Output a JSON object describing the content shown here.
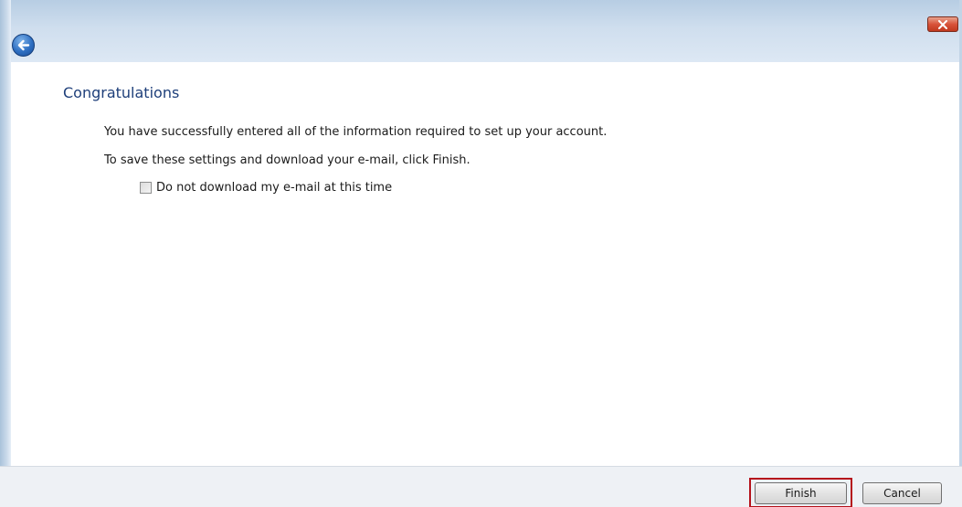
{
  "dialog": {
    "close_icon": "close-icon",
    "back_icon": "back-arrow-icon",
    "heading": "Congratulations",
    "message_line1": "You have successfully entered all of the information required to set up your account.",
    "message_line2": "To save these settings and download your e-mail, click Finish.",
    "checkbox": {
      "label": "Do not download my e-mail at this time",
      "checked": false
    }
  },
  "footer": {
    "finish_label": "Finish",
    "cancel_label": "Cancel",
    "highlight_color": "#b5121b"
  }
}
